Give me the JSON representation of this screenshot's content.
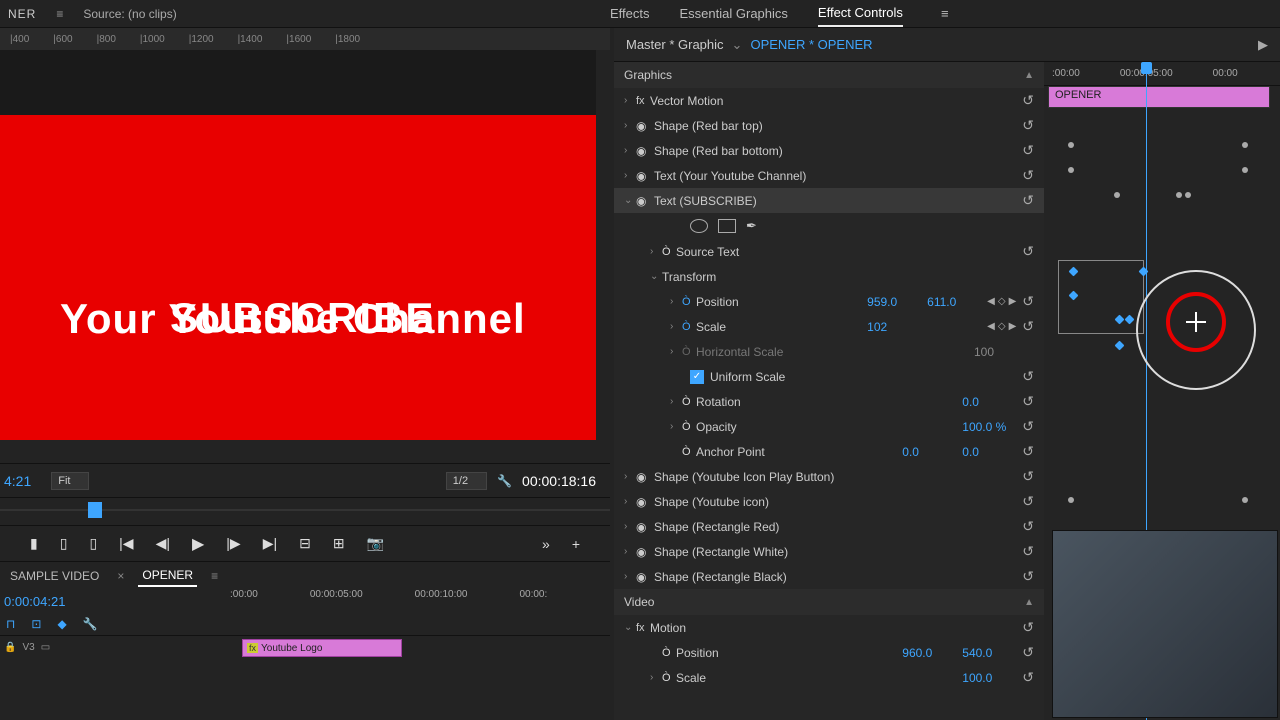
{
  "topbar": {
    "panel": "NER",
    "source_label": "Source: (no clips)"
  },
  "tabs": {
    "effects": "Effects",
    "eg": "Essential Graphics",
    "ec": "Effect Controls"
  },
  "ruler_ticks": [
    "|400",
    "|600",
    "|800",
    "|1000",
    "|1200",
    "|1400",
    "|1600",
    "|1800"
  ],
  "preview": {
    "line1": "Your Youtube Channel",
    "line2": "SUBSCRIBE"
  },
  "playbar": {
    "tc_left": "4:21",
    "fit": "Fit",
    "res": "1/2",
    "tc_right": "00:00:18:16"
  },
  "seq_tabs": {
    "t1": "SAMPLE VIDEO",
    "t2": "OPENER"
  },
  "timeline": {
    "tc": "0:00:04:21",
    "ruler": [
      ":00:00",
      "00:00:05:00",
      "00:00:10:00",
      "00:00:"
    ],
    "track_label": "V3",
    "clip_name": "Youtube Logo"
  },
  "ec_head": {
    "master": "Master * Graphic",
    "seq": "OPENER * OPENER"
  },
  "ec_ruler": {
    "t0": ":00:00",
    "t1": "00:00:05:00",
    "t2": "00:00"
  },
  "ec_clip": "OPENER",
  "sections": {
    "graphics": "Graphics",
    "video": "Video"
  },
  "props": {
    "vector_motion": "Vector Motion",
    "red_bar_top": "Shape (Red bar top)",
    "red_bar_bottom": "Shape (Red bar bottom)",
    "text_channel": "Text (Your Youtube Channel)",
    "text_subscribe": "Text (SUBSCRIBE)",
    "source_text": "Source Text",
    "transform": "Transform",
    "position": "Position",
    "pos_x": "959.0",
    "pos_y": "611.0",
    "scale": "Scale",
    "scale_v": "102",
    "hscale": "Horizontal Scale",
    "hscale_v": "100",
    "uniform": "Uniform Scale",
    "rotation": "Rotation",
    "rotation_v": "0.0",
    "opacity": "Opacity",
    "opacity_v": "100.0 %",
    "anchor": "Anchor Point",
    "anchor_x": "0.0",
    "anchor_y": "0.0",
    "yt_play": "Shape (Youtube Icon Play Button)",
    "yt_icon": "Shape (Youtube icon)",
    "rect_red": "Shape (Rectangle Red)",
    "rect_white": "Shape (Rectangle White)",
    "rect_black": "Shape (Rectangle Black)",
    "motion": "Motion",
    "m_pos": "Position",
    "m_pos_x": "960.0",
    "m_pos_y": "540.0",
    "m_scale": "Scale",
    "m_scale_v": "100.0"
  }
}
